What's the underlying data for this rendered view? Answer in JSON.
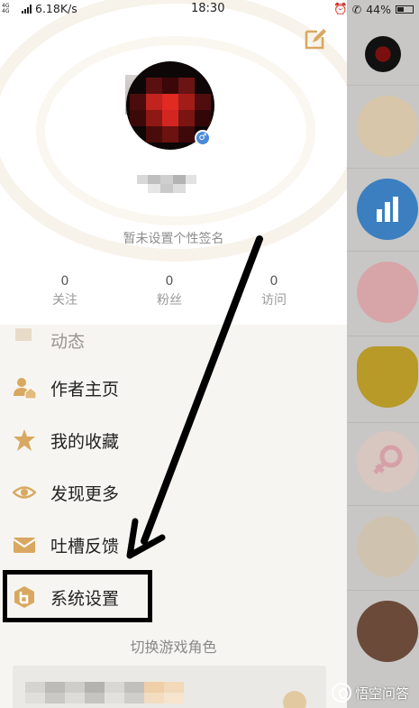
{
  "status_bar": {
    "network": "4G 4G",
    "speed": "6.18K/s",
    "time": "18:30",
    "battery": "44%"
  },
  "profile": {
    "signature": "暂未设置个性签名",
    "stats": [
      {
        "value": "0",
        "label": "关注"
      },
      {
        "value": "0",
        "label": "粉丝"
      },
      {
        "value": "0",
        "label": "访问"
      }
    ]
  },
  "menu": {
    "items": [
      {
        "label": "动态",
        "icon": "flag-icon"
      },
      {
        "label": "作者主页",
        "icon": "author-icon"
      },
      {
        "label": "我的收藏",
        "icon": "star-icon"
      },
      {
        "label": "发现更多",
        "icon": "eye-icon"
      },
      {
        "label": "吐槽反馈",
        "icon": "mail-icon"
      },
      {
        "label": "系统设置",
        "icon": "settings-icon"
      }
    ],
    "switch_role_title": "切换游戏角色"
  },
  "watermark": "悟空问答",
  "colors": {
    "accent": "#d9a860",
    "drawer_bg": "#f6f5f2",
    "highlight_border": "#000000"
  }
}
